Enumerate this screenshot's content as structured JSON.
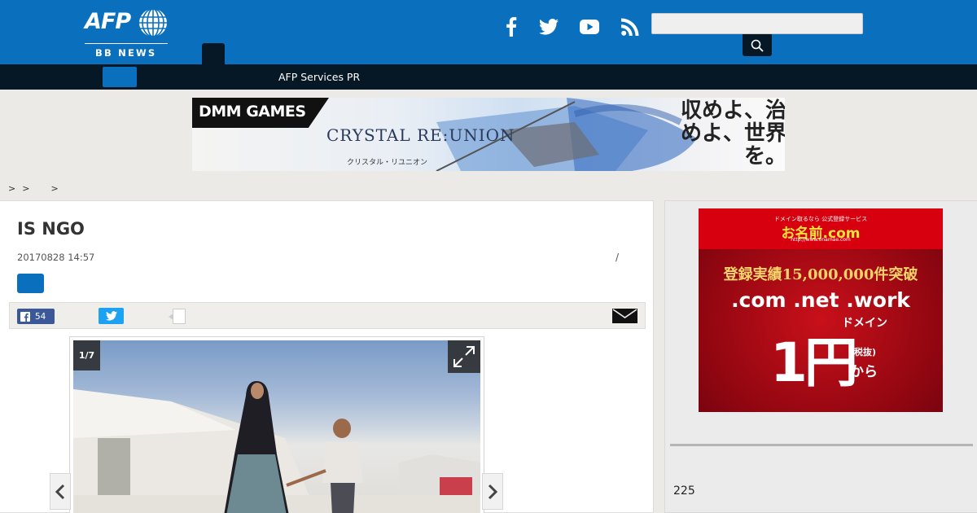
{
  "header": {
    "logo_text": "AFP",
    "logo_sub": "BB NEWS",
    "social": [
      "facebook-icon",
      "twitter-icon",
      "youtube-icon",
      "rss-icon"
    ],
    "search_value": "",
    "search_placeholder": "",
    "brand_color": "#0a70bd",
    "dark_color": "#061826"
  },
  "nav": {
    "link": "AFP Services PR"
  },
  "banner_ad": {
    "brand": "DMM GAMES",
    "game_title": "CRYSTAL RE:UNION",
    "game_subtitle": "クリスタル・リユニオン",
    "slogan": "収めよ、治めよ、世界を。"
  },
  "breadcrumb": [
    ">",
    ">",
    ">"
  ],
  "article": {
    "title": "IS NGO",
    "datetime": "20170828 14:57",
    "slash": "/",
    "facebook_count": "54",
    "gallery_counter": "1/7"
  },
  "sidebar": {
    "ad": {
      "small_text": "ドメイン取るなら 公式登録サービス",
      "brand": "お名前.com",
      "url": "http://www.onamae.com",
      "count_text": "登録実績15,000,000件突破",
      "domains": ".com .net .work",
      "domain_word": "ドメイン",
      "price": "1円",
      "tax": "(税抜)",
      "kara": "から"
    },
    "count": "225"
  }
}
